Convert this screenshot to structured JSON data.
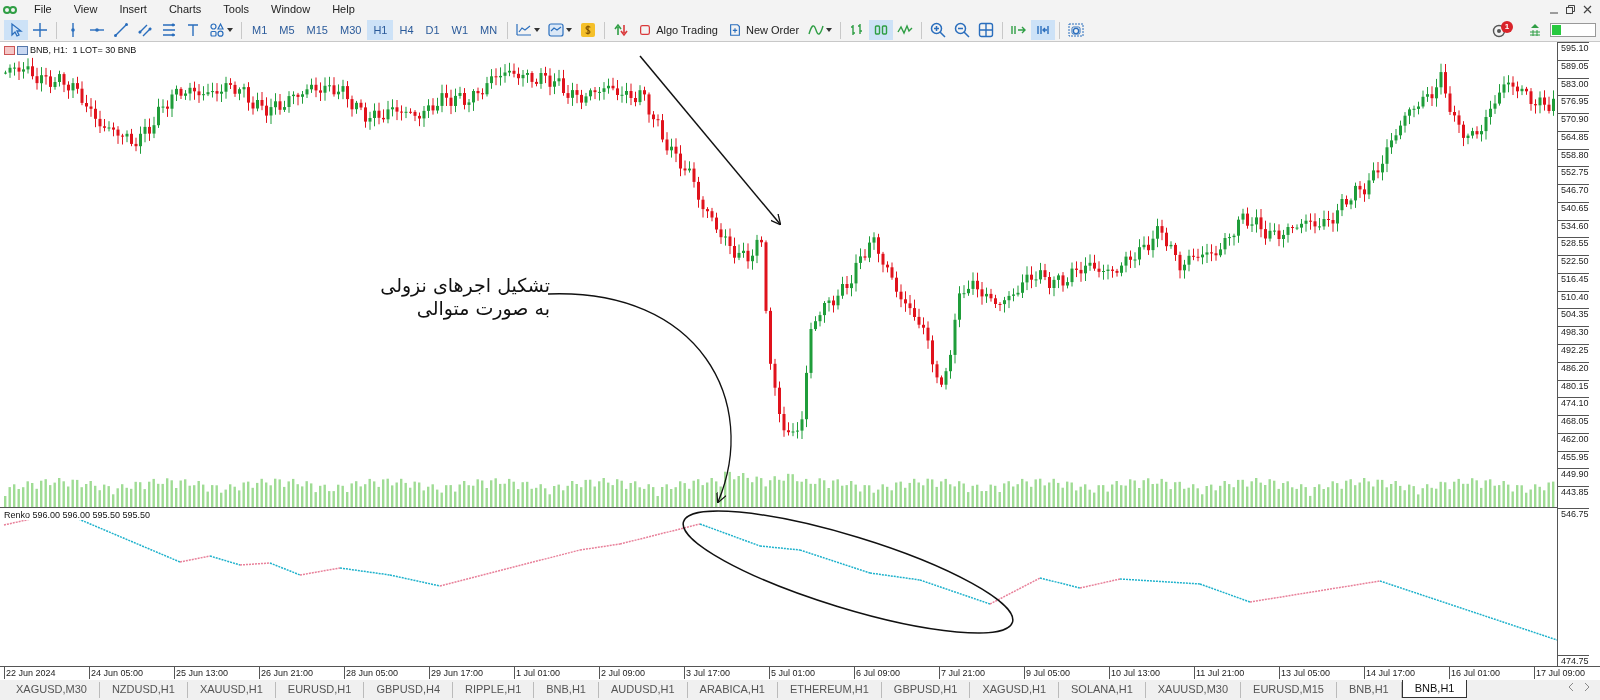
{
  "menu": [
    "File",
    "View",
    "Insert",
    "Charts",
    "Tools",
    "Window",
    "Help"
  ],
  "toolbar": {
    "items": [
      {
        "kind": "cursor",
        "selected": true
      },
      {
        "kind": "crosshair",
        "selected": false
      },
      {
        "kind": "separator"
      },
      {
        "kind": "vline",
        "selected": false
      },
      {
        "kind": "hline",
        "selected": false
      },
      {
        "kind": "trendline",
        "selected": false
      },
      {
        "kind": "channel",
        "selected": false
      },
      {
        "kind": "fibo",
        "selected": false
      },
      {
        "kind": "text",
        "selected": false
      },
      {
        "kind": "shapes",
        "selected": false
      },
      {
        "kind": "separator"
      },
      {
        "kind": "timeframe",
        "label": "M1",
        "selected": false
      },
      {
        "kind": "timeframe",
        "label": "M5",
        "selected": false
      },
      {
        "kind": "timeframe",
        "label": "M15",
        "selected": false
      },
      {
        "kind": "timeframe",
        "label": "M30",
        "selected": false
      },
      {
        "kind": "timeframe",
        "label": "H1",
        "selected": true
      },
      {
        "kind": "timeframe",
        "label": "H4",
        "selected": false
      },
      {
        "kind": "timeframe",
        "label": "D1",
        "selected": false
      },
      {
        "kind": "timeframe",
        "label": "W1",
        "selected": false
      },
      {
        "kind": "timeframe",
        "label": "MN",
        "selected": false
      },
      {
        "kind": "separator"
      },
      {
        "kind": "indicators",
        "selected": false
      },
      {
        "kind": "templates",
        "selected": false
      },
      {
        "kind": "signals",
        "selected": false
      },
      {
        "kind": "separator"
      },
      {
        "kind": "oneclick",
        "selected": false
      },
      {
        "kind": "button",
        "label": "Algo Trading"
      },
      {
        "kind": "button",
        "label": "New Order"
      },
      {
        "kind": "linechart",
        "selected": false
      },
      {
        "kind": "separator"
      },
      {
        "kind": "bars",
        "selected": false
      },
      {
        "kind": "candles",
        "selected": true
      },
      {
        "kind": "line",
        "selected": false
      },
      {
        "kind": "separator"
      },
      {
        "kind": "zoomin",
        "selected": false
      },
      {
        "kind": "zoomout",
        "selected": false
      },
      {
        "kind": "grid",
        "selected": false
      },
      {
        "kind": "separator"
      },
      {
        "kind": "autoscroll",
        "selected": false
      },
      {
        "kind": "shift",
        "selected": true
      },
      {
        "kind": "separator"
      },
      {
        "kind": "screenshot",
        "selected": false
      }
    ],
    "notifications": "1"
  },
  "chart": {
    "header": "BNB, H1:  1 LOT= 30 BNB",
    "price_labels": [
      "595.10",
      "589.05",
      "583.00",
      "576.95",
      "570.90",
      "564.85",
      "558.80",
      "552.75",
      "546.70",
      "540.65",
      "534.60",
      "528.55",
      "522.50",
      "516.45",
      "510.40",
      "504.35",
      "498.30",
      "492.25",
      "486.20",
      "480.15",
      "474.10",
      "468.05",
      "462.00",
      "455.95",
      "449.90",
      "443.85"
    ],
    "indicator": {
      "header": "Renko 596.00 596.00 595.50 595.50",
      "price_labels": [
        "546.75",
        "474.75"
      ]
    },
    "time_labels": [
      "22 Jun 2024",
      "24 Jun 05:00",
      "25 Jun 13:00",
      "26 Jun 21:00",
      "28 Jun 05:00",
      "29 Jun 17:00",
      "1 Jul 01:00",
      "2 Jul 09:00",
      "3 Jul 17:00",
      "5 Jul 01:00",
      "6 Jul 09:00",
      "7 Jul 21:00",
      "9 Jul 05:00",
      "10 Jul 13:00",
      "11 Jul 21:00",
      "13 Jul 05:00",
      "14 Jul 17:00",
      "16 Jul 01:00",
      "17 Jul 09:00"
    ]
  },
  "annotation": {
    "text": "تشکیل اجرهای نزولی\nبه صورت متوالی"
  },
  "tabs": [
    {
      "label": "XAGUSD,M30",
      "selected": false
    },
    {
      "label": "NZDUSD,H1",
      "selected": false
    },
    {
      "label": "XAUUSD,H1",
      "selected": false
    },
    {
      "label": "EURUSD,H1",
      "selected": false
    },
    {
      "label": "GBPUSD,H4",
      "selected": false
    },
    {
      "label": "RIPPLE,H1",
      "selected": false
    },
    {
      "label": "BNB,H1",
      "selected": false
    },
    {
      "label": "AUDUSD,H1",
      "selected": false
    },
    {
      "label": "ARABICA,H1",
      "selected": false
    },
    {
      "label": "ETHEREUM,H1",
      "selected": false
    },
    {
      "label": "GBPUSD,H1",
      "selected": false
    },
    {
      "label": "XAGUSD,H1",
      "selected": false
    },
    {
      "label": "SOLANA,H1",
      "selected": false
    },
    {
      "label": "XAUUSD,M30",
      "selected": false
    },
    {
      "label": "EURUSD,M15",
      "selected": false
    },
    {
      "label": "BNB,H1",
      "selected": false
    },
    {
      "label": "BNB,H1",
      "selected": true
    }
  ]
}
